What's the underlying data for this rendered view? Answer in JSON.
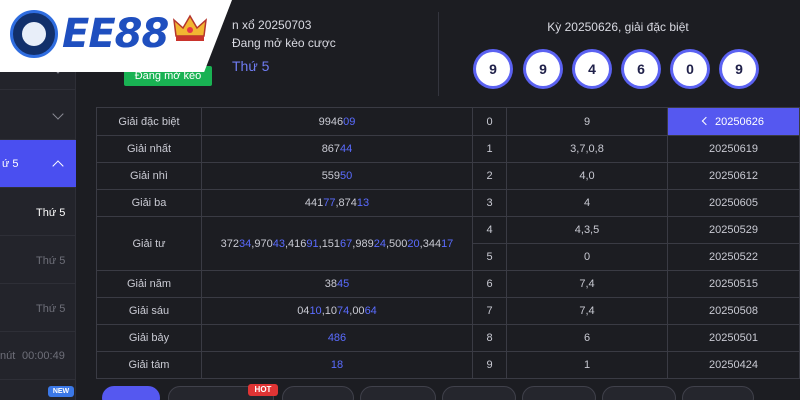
{
  "brand": {
    "logo_text": "EE88"
  },
  "sidebar": {
    "items": [
      {
        "label": ""
      },
      {
        "label": ""
      },
      {
        "label": "ứ 5"
      },
      {
        "label": "Thứ 5"
      },
      {
        "label": "Thứ 5"
      },
      {
        "label": "Thứ 5"
      },
      {
        "label": "nút",
        "time": "00:00:49"
      }
    ],
    "new_badge": "NEW"
  },
  "header": {
    "draw_label": "n xổ 20250703",
    "status_text": "Đang mở kèo cược",
    "status_badge": "Đang mở kèo",
    "weekday": "Thứ 5",
    "result_title": "Kỳ 20250626, giải đặc biệt",
    "balls": [
      "9",
      "9",
      "4",
      "6",
      "0",
      "9"
    ]
  },
  "prize_table": [
    {
      "label": "Giải đặc biệt",
      "value_plain": "9946",
      "value_accent": "09"
    },
    {
      "label": "Giải nhất",
      "value_plain": "867",
      "value_accent": "44"
    },
    {
      "label": "Giải nhì",
      "value_plain": "559",
      "value_accent": "50"
    },
    {
      "label": "Giải ba",
      "value_plain": "441",
      "value_accent": "77",
      "value_plain2": ",874",
      "value_accent2": "13"
    },
    {
      "label": "Giải tư",
      "value": "37234,97043,41691,15167,98924,50020,34417"
    },
    {
      "label": "Giải năm",
      "value_plain": "38",
      "value_accent": "45"
    },
    {
      "label": "Giải sáu",
      "value": "0410,1074,0064"
    },
    {
      "label": "Giải bảy",
      "value_accent": "486"
    },
    {
      "label": "Giải tám",
      "value_accent": "18"
    }
  ],
  "digit_table": [
    {
      "digit": "0",
      "values": "9"
    },
    {
      "digit": "1",
      "values": "3,7,0,8"
    },
    {
      "digit": "2",
      "values": "4,0"
    },
    {
      "digit": "3",
      "values": "4"
    },
    {
      "digit": "4",
      "values": "4,3,5"
    },
    {
      "digit": "5",
      "values": "0"
    },
    {
      "digit": "6",
      "values": "7,4"
    },
    {
      "digit": "7",
      "values": "7,4"
    },
    {
      "digit": "8",
      "values": "6"
    },
    {
      "digit": "9",
      "values": "1"
    }
  ],
  "history": [
    "20250626",
    "20250619",
    "20250612",
    "20250605",
    "20250529",
    "20250522",
    "20250515",
    "20250508",
    "20250501",
    "20250424"
  ],
  "bottom_tabs": {
    "hot_badge": "HOT"
  },
  "colors": {
    "accent": "#5558f0",
    "status_green": "#19b253",
    "number_blue": "#5a6cff"
  }
}
